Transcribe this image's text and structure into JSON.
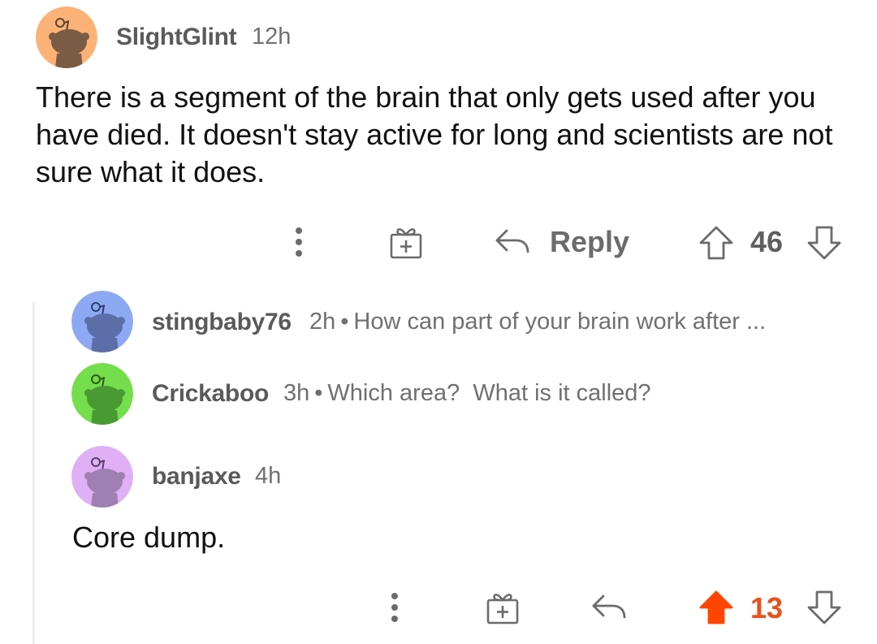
{
  "colors": {
    "upvote_active": "#ff4500",
    "avatar_orange": "#fcb277",
    "avatar_blue": "#8ea9f3",
    "avatar_green": "#75de4c",
    "avatar_purple": "#e0b0f7"
  },
  "top_comment": {
    "username": "SlightGlint",
    "age": "12h",
    "body": "There is a segment of the brain that only gets used after you have died. It doesn't stay active for long and scientists are not sure what it does.",
    "reply_label": "Reply",
    "score": "46",
    "avatar_icon": "snoo-avatar-icon"
  },
  "collapsed_replies": [
    {
      "username": "stingbaby76",
      "age": "2h",
      "separator": "•",
      "preview": "How can part of your brain work after ..."
    },
    {
      "username": "Crickaboo",
      "age": "3h",
      "separator": "•",
      "preview": "Which area?  What is it called?"
    }
  ],
  "reply_comment": {
    "username": "banjaxe",
    "age": "4h",
    "body": "Core dump.",
    "score": "13",
    "upvoted": true
  }
}
